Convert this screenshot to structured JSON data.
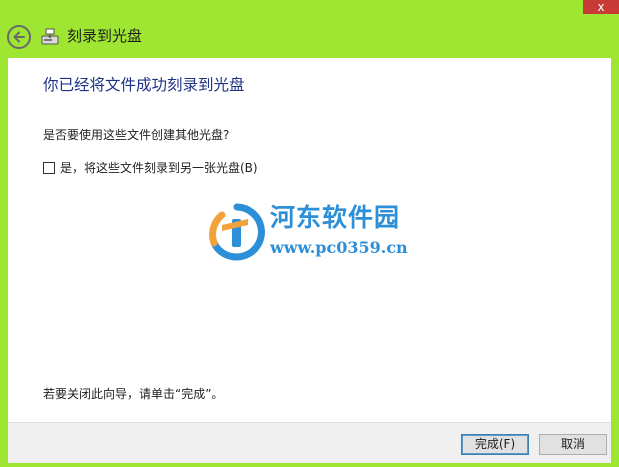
{
  "window": {
    "title": "刻录到光盘",
    "close_label": "x"
  },
  "content": {
    "heading": "你已经将文件成功刻录到光盘",
    "question": "是否要使用这些文件创建其他光盘?",
    "checkbox": {
      "label": "是，将这些文件刻录到另一张光盘(B)",
      "checked": false
    },
    "close_hint": "若要关闭此向导，请单击“完成”。"
  },
  "watermark": {
    "title": "河东软件园",
    "url": "www.pc0359.cn"
  },
  "footer": {
    "finish_label": "完成(F)",
    "cancel_label": "取消"
  },
  "colors": {
    "frame": "#9ee632",
    "heading": "#1e3287",
    "watermark_blue": "#2c8fd8",
    "watermark_orange": "#f2a23a",
    "close_red": "#c73b34"
  },
  "icons": {
    "back": "back-arrow-icon",
    "burn": "burn-disc-icon",
    "close": "close-icon",
    "watermark_logo": "hedong-logo-icon"
  }
}
